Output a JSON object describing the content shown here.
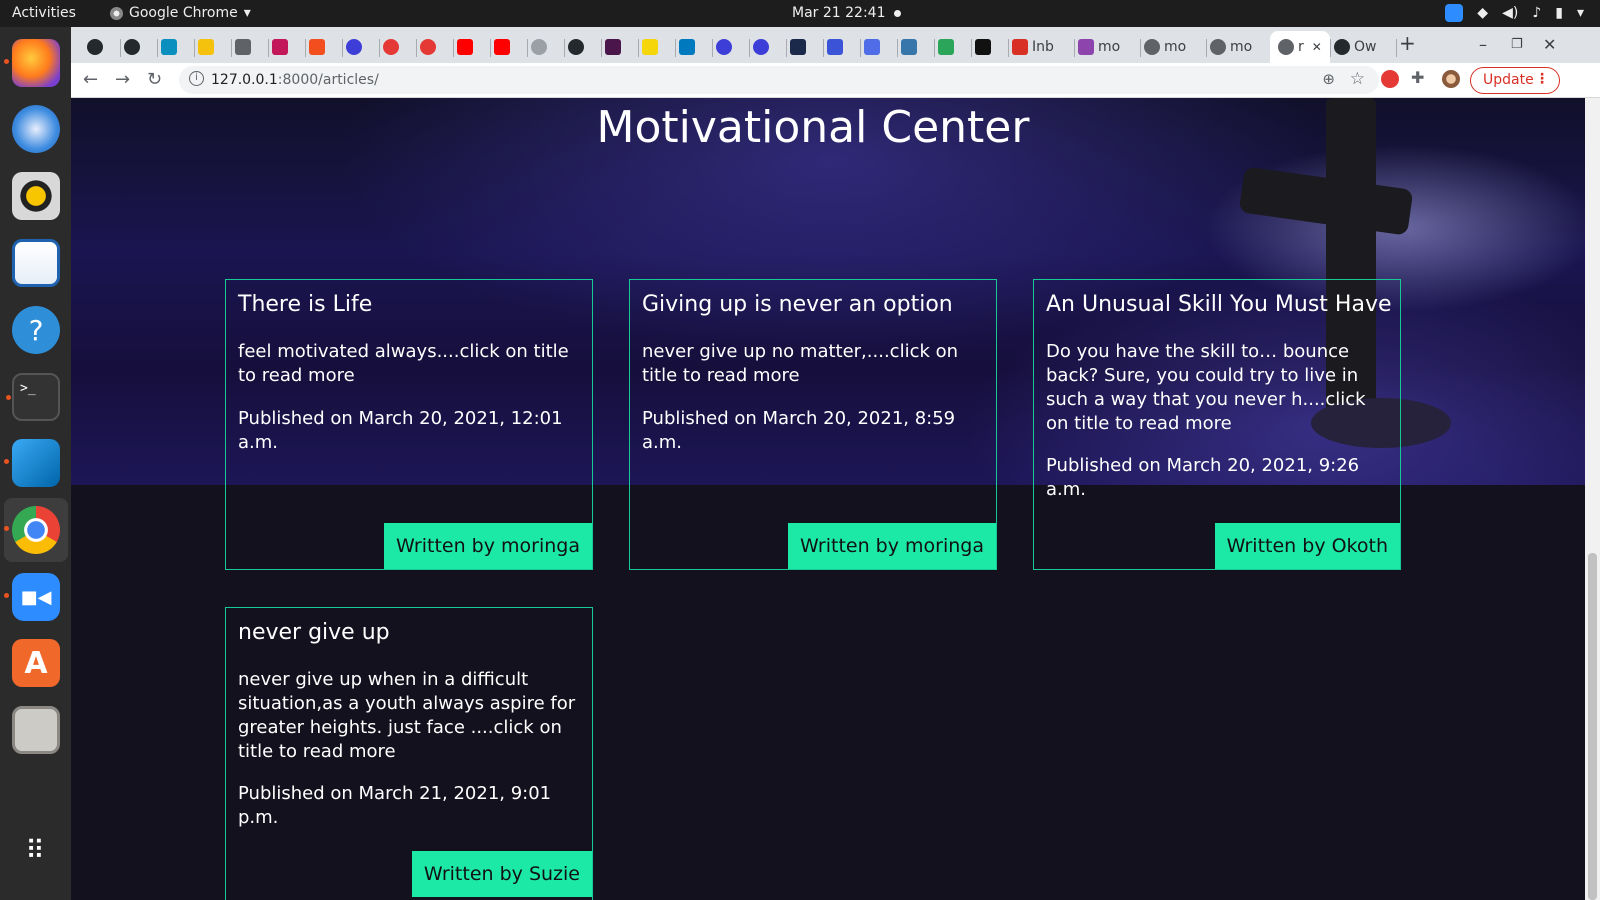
{
  "system": {
    "activities": "Activities",
    "app_name": "Google Chrome",
    "clock": "Mar 21  22:41"
  },
  "dock": {
    "items": [
      "firefox-icon",
      "thunderbird-icon",
      "rhythmbox-icon",
      "libreoffice-writer-icon",
      "help-icon",
      "terminal-icon",
      "vscode-icon",
      "chrome-icon",
      "zoom-icon",
      "software-center-icon",
      "files-icon",
      "show-apps-icon"
    ]
  },
  "browser": {
    "tabs": [
      {
        "label": "",
        "icon": "github-icon",
        "color": "#24292e"
      },
      {
        "label": "",
        "icon": "github-icon",
        "color": "#24292e"
      },
      {
        "label": "",
        "icon": "jira-icon",
        "color": "#0a8fbf"
      },
      {
        "label": "",
        "icon": "sentry-icon",
        "color": "#f4c20d"
      },
      {
        "label": "",
        "icon": "generic-icon",
        "color": "#5f6368"
      },
      {
        "label": "",
        "icon": "record-icon",
        "color": "#c2185b"
      },
      {
        "label": "",
        "icon": "figma-icon",
        "color": "#f24e1e"
      },
      {
        "label": "",
        "icon": "c-icon",
        "color": "#3d3dd8"
      },
      {
        "label": "",
        "icon": "ring-icon",
        "color": "#e53935"
      },
      {
        "label": "",
        "icon": "ring-icon",
        "color": "#e53935"
      },
      {
        "label": "",
        "icon": "youtube-icon",
        "color": "#ff0000"
      },
      {
        "label": "",
        "icon": "youtube-icon",
        "color": "#ff0000"
      },
      {
        "label": "",
        "icon": "globe-icon",
        "color": "#9aa0a6"
      },
      {
        "label": "",
        "icon": "github-icon",
        "color": "#24292e"
      },
      {
        "label": "",
        "icon": "slack-icon",
        "color": "#4a154b"
      },
      {
        "label": "",
        "icon": "pacman-icon",
        "color": "#f4d60b"
      },
      {
        "label": "",
        "icon": "trello-icon",
        "color": "#0079bf"
      },
      {
        "label": "",
        "icon": "c-icon",
        "color": "#3d3dd8"
      },
      {
        "label": "",
        "icon": "c-icon",
        "color": "#3d3dd8"
      },
      {
        "label": "",
        "icon": "terminal-tab-icon",
        "color": "#1b2a4a"
      },
      {
        "label": "",
        "icon": "sidebar-icon",
        "color": "#3b53d6"
      },
      {
        "label": "",
        "icon": "docs-icon",
        "color": "#4f6de6"
      },
      {
        "label": "",
        "icon": "python-icon",
        "color": "#3776ab"
      },
      {
        "label": "",
        "icon": "w-icon",
        "color": "#2aa55a"
      },
      {
        "label": "",
        "icon": "triangle-icon",
        "color": "#111111"
      },
      {
        "label": "Inb",
        "icon": "gmail-icon",
        "color": "#d93025"
      },
      {
        "label": "mo",
        "icon": "h-icon",
        "color": "#8e44ad"
      },
      {
        "label": "mo",
        "icon": "globe-icon",
        "color": "#5f6368"
      },
      {
        "label": "mo",
        "icon": "globe-icon",
        "color": "#5f6368"
      },
      {
        "label": "r",
        "icon": "globe-icon",
        "color": "#5f6368",
        "active": true
      },
      {
        "label": "Ow",
        "icon": "github-icon",
        "color": "#24292e"
      }
    ],
    "new_tab": "+",
    "url_host": "127.0.0.1",
    "url_path": ":8000/articles/",
    "update_label": "Update"
  },
  "page": {
    "title": "Motivational Center",
    "articles": [
      {
        "title": "There is Life",
        "excerpt": "feel motivated always....click on title to read more",
        "date": "Published on March 20, 2021, 12:01 a.m.",
        "author": "Written by moringa"
      },
      {
        "title": "Giving up is never an option",
        "excerpt": "never give up no matter,....click on title to read more",
        "date": "Published on March 20, 2021, 8:59 a.m.",
        "author": "Written by moringa"
      },
      {
        "title": "An Unusual Skill You Must Have",
        "excerpt": "Do you have the skill to… bounce back? Sure, you could try to live in such a way that you never h....click on title to read more",
        "date": "Published on March 20, 2021, 9:26 a.m.",
        "author": "Written by Okoth"
      },
      {
        "title": "never give up",
        "excerpt": "never give up when in a difficult situation,as a youth always aspire for greater heights. just face ....click on title to read more",
        "date": "Published on March 21, 2021, 9:01 p.m.",
        "author": "Written by Suzie"
      }
    ]
  },
  "colors": {
    "card_border": "#17c995",
    "author_badge": "#1de9a6",
    "page_bg": "#13111e"
  }
}
